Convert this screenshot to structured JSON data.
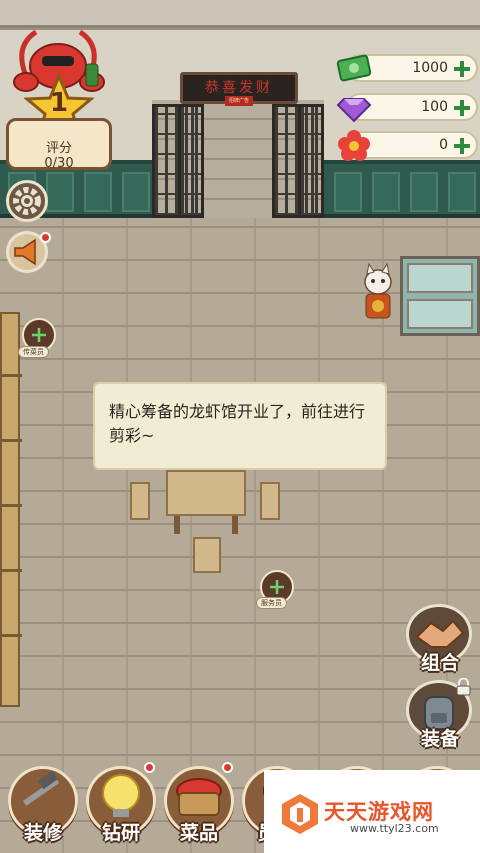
{
  "shop": {
    "sign": "恭喜发财",
    "sign_sub": "招牌广告"
  },
  "player": {
    "level": "1",
    "rating_label": "评分",
    "rating_value": "0/30"
  },
  "currencies": [
    {
      "name": "cash",
      "icon": "cash-icon",
      "amount": "1000",
      "color": "#4caf50"
    },
    {
      "name": "diamond",
      "icon": "diamond-icon",
      "amount": "100",
      "color": "#a05ad8"
    },
    {
      "name": "flower",
      "icon": "flower-icon",
      "amount": "0",
      "color": "#e8433a"
    }
  ],
  "stations": [
    {
      "label": "传菜员"
    },
    {
      "label": "服务员"
    }
  ],
  "dialog": {
    "text": "精心筹备的龙虾馆开业了，前往进行剪彩~"
  },
  "side_buttons": {
    "combo_label": "组合",
    "equip_label": "装备"
  },
  "menu": [
    {
      "label": "装修",
      "icon": "hammer-wrench-icon",
      "badge": false
    },
    {
      "label": "钻研",
      "icon": "lightbulb-icon",
      "badge": true
    },
    {
      "label": "菜品",
      "icon": "crayfish-basket-icon",
      "badge": true
    },
    {
      "label": "员",
      "icon": "staff-icon",
      "badge": false
    }
  ],
  "watermark": {
    "title": "天天游戏网",
    "url": "www.ttyl23.com"
  },
  "colors": {
    "plus": "#2e8b3e",
    "badge": "#d93a2f",
    "wainscot": "#2f5b4e"
  }
}
